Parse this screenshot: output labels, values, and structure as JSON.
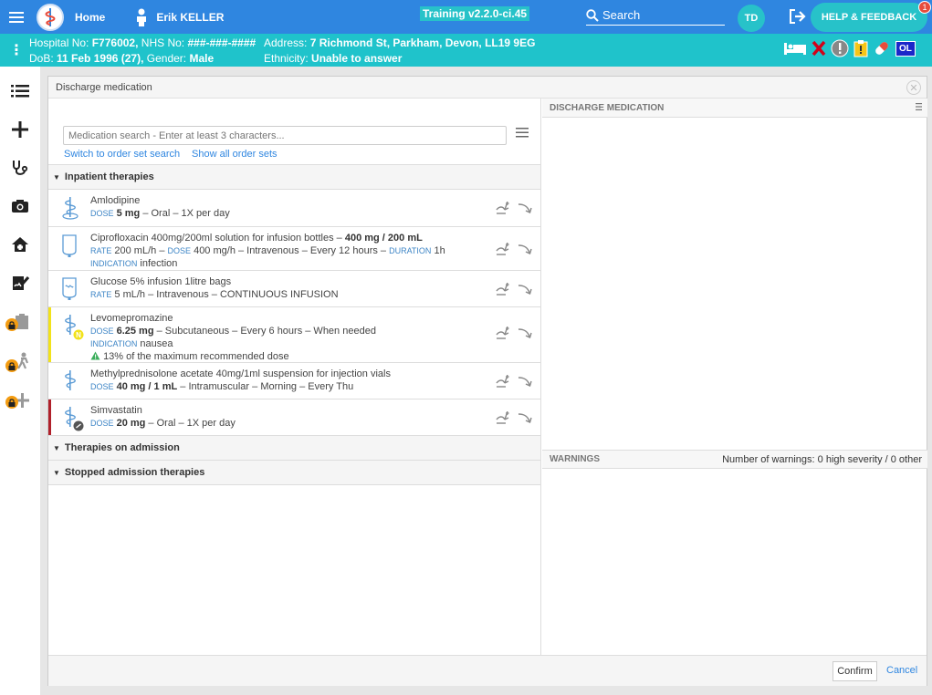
{
  "topbar": {
    "home_label": "Home",
    "user_name": "Erik KELLER",
    "training_label": "Training v2.2.0-ci.45",
    "search_label": "Search",
    "avatar_initials": "TD",
    "help_label": "HELP & FEEDBACK",
    "help_badge_count": "1"
  },
  "patient": {
    "hospital_no_label": "Hospital No:",
    "hospital_no": "F776002,",
    "nhs_no_label": "NHS No:",
    "nhs_no": "###-###-####",
    "address_label": "Address:",
    "address": "7 Richmond St, Parkham, Devon, LL19 9EG",
    "dob_label": "DoB:",
    "dob": "11 Feb 1996 (27),",
    "gender_label": "Gender:",
    "gender": "Male",
    "ethnicity_label": "Ethnicity:",
    "ethnicity": "Unable to answer",
    "ol_badge": "OL"
  },
  "modal": {
    "title": "Discharge medication",
    "search_placeholder": "Medication search - Enter at least 3 characters...",
    "link_order_set": "Switch to order set search",
    "link_all_sets": "Show all order sets",
    "sections": {
      "inpatient": "Inpatient therapies",
      "admission": "Therapies on admission",
      "stopped": "Stopped admission therapies"
    },
    "right_header": "DISCHARGE MEDICATION",
    "warnings_header": "WARNINGS",
    "warnings_count": "Number of warnings: 0 high severity / 0 other",
    "confirm_label": "Confirm",
    "cancel_label": "Cancel"
  },
  "medications": [
    {
      "name": "Amlodipine",
      "l1_lbl": "DOSE",
      "l1_val": "5 mg",
      "l1_rest": " – Oral – 1X per day"
    },
    {
      "name_pre": "Ciprofloxacin 400mg/200ml solution for infusion bottles – ",
      "name_bold": "400 mg / 200 mL",
      "l1_lbl": "RATE",
      "l1_a": " 200 mL/h – ",
      "l1_lbl2": "DOSE",
      "l1_b": " 400 mg/h – Intravenous – Every 12 hours – ",
      "l1_lbl3": "DURATION",
      "l1_c": " 1h",
      "l2_lbl": "INDICATION",
      "l2_val": " infection"
    },
    {
      "name": "Glucose 5% infusion 1litre bags",
      "l1_lbl": "RATE",
      "l1_rest": " 5 mL/h – Intravenous – CONTINUOUS INFUSION"
    },
    {
      "name": "Levomepromazine",
      "l1_lbl": "DOSE",
      "l1_val": "6.25 mg",
      "l1_rest": " – Subcutaneous – Every 6 hours – When needed",
      "l2_lbl": "INDICATION",
      "l2_val": " nausea",
      "l3": "13% of the maximum recommended dose",
      "prn_badge": "N"
    },
    {
      "name": "Methylprednisolone acetate 40mg/1ml suspension for injection vials",
      "l1_lbl": "DOSE",
      "l1_val": "40 mg / 1 mL",
      "l1_rest": " – Intramuscular – Morning – Every Thu"
    },
    {
      "name": "Simvastatin",
      "l1_lbl": "DOSE",
      "l1_val": "20 mg",
      "l1_rest": " – Oral – 1X per day"
    }
  ],
  "colors": {
    "topbar": "#2f86e0",
    "patientbar": "#1fc3cb",
    "accent": "#27c2c9",
    "flag_yellow": "#f2e21a",
    "flag_red": "#b0202a",
    "lock": "#f39c12"
  }
}
